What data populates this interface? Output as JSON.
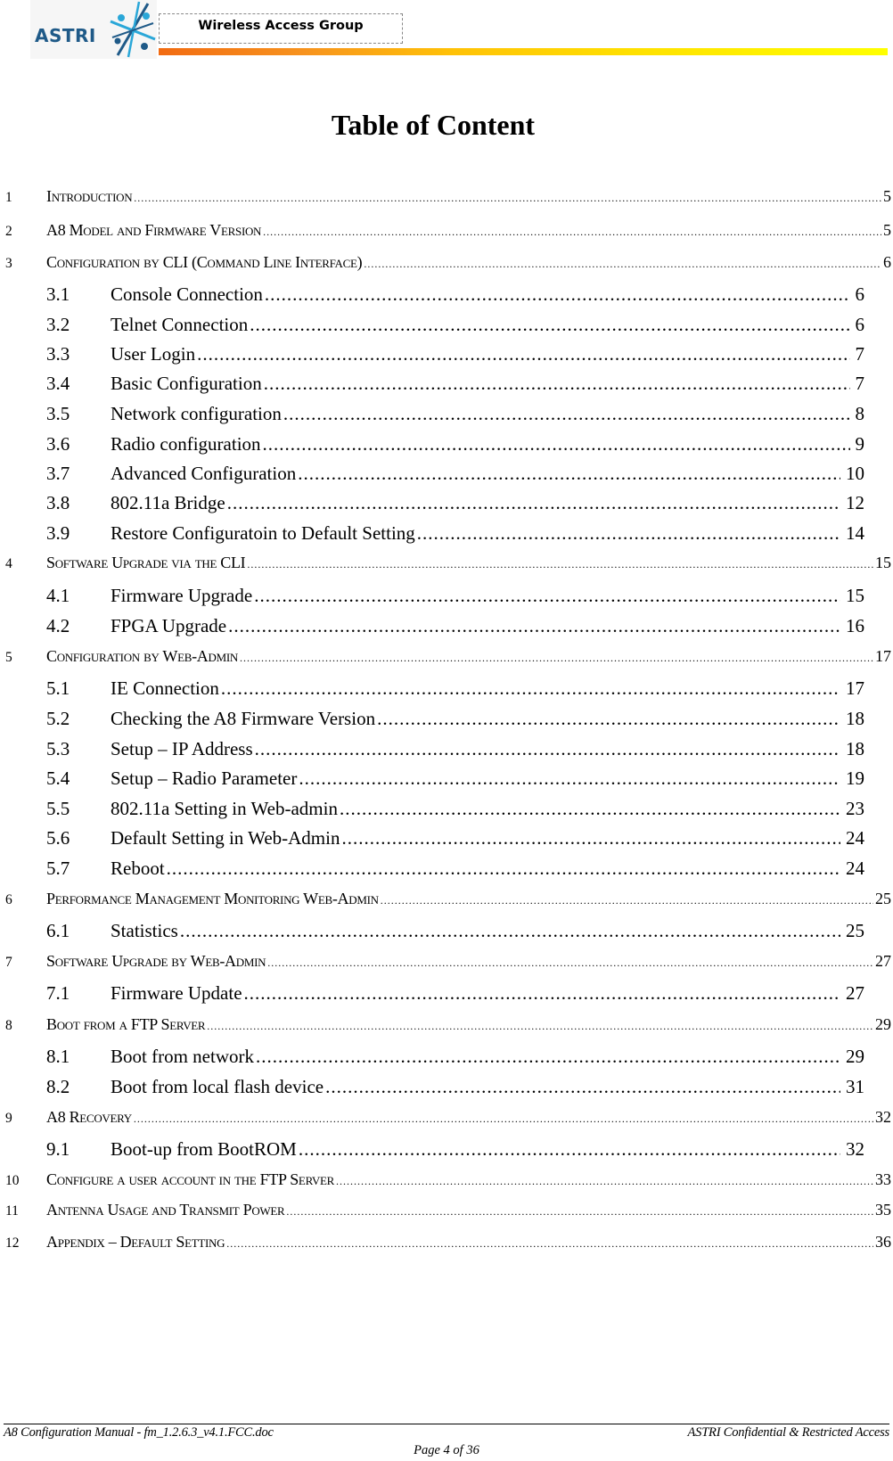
{
  "header": {
    "logo_text": "ASTRI",
    "group_label": "Wireless Access Group",
    "colors": {
      "logo_blue": "#1f5a88",
      "logo_cyan": "#2aa7d8",
      "bar_start": "#f26b12",
      "bar_end": "#ffff00"
    }
  },
  "title": "Table of Content",
  "toc": [
    {
      "level": 1,
      "num": "1",
      "title": "Introduction",
      "page": "5"
    },
    {
      "level": 1,
      "num": "2",
      "title": "A8 Model and Firmware Version",
      "page": "5"
    },
    {
      "level": 1,
      "num": "3",
      "title": "Configuration by CLI (Command Line Interface)",
      "page": "6"
    },
    {
      "level": 2,
      "num": "3.1",
      "title": "Console Connection",
      "page": "6"
    },
    {
      "level": 2,
      "num": "3.2",
      "title": "Telnet Connection",
      "page": "6"
    },
    {
      "level": 2,
      "num": "3.3",
      "title": "User Login",
      "page": "7"
    },
    {
      "level": 2,
      "num": "3.4",
      "title": "Basic Configuration",
      "page": "7"
    },
    {
      "level": 2,
      "num": "3.5",
      "title": "Network configuration",
      "page": "8"
    },
    {
      "level": 2,
      "num": "3.6",
      "title": "Radio configuration",
      "page": "9"
    },
    {
      "level": 2,
      "num": "3.7",
      "title": "Advanced Configuration",
      "page": "10"
    },
    {
      "level": 2,
      "num": "3.8",
      "title": "802.11a Bridge",
      "page": "12"
    },
    {
      "level": 2,
      "num": "3.9",
      "title": "Restore Configuratoin to Default Setting",
      "page": "14"
    },
    {
      "level": 1,
      "num": "4",
      "title": "Software Upgrade via the CLI",
      "page": "15"
    },
    {
      "level": 2,
      "num": "4.1",
      "title": "Firmware Upgrade",
      "page": "15"
    },
    {
      "level": 2,
      "num": "4.2",
      "title": "FPGA Upgrade",
      "page": "16"
    },
    {
      "level": 1,
      "num": "5",
      "title": "Configuration by Web-Admin",
      "page": "17"
    },
    {
      "level": 2,
      "num": "5.1",
      "title": "IE Connection",
      "page": "17"
    },
    {
      "level": 2,
      "num": "5.2",
      "title": "Checking the A8 Firmware Version",
      "page": "18"
    },
    {
      "level": 2,
      "num": "5.3",
      "title": "Setup – IP Address",
      "page": "18"
    },
    {
      "level": 2,
      "num": "5.4",
      "title": "Setup – Radio Parameter",
      "page": "19"
    },
    {
      "level": 2,
      "num": "5.5",
      "title": "802.11a Setting in Web-admin",
      "page": "23"
    },
    {
      "level": 2,
      "num": "5.6",
      "title": "Default Setting in Web-Admin",
      "page": "24"
    },
    {
      "level": 2,
      "num": "5.7",
      "title": "Reboot",
      "page": "24"
    },
    {
      "level": 1,
      "num": "6",
      "title": "Performance Management Monitoring Web-Admin",
      "page": "25"
    },
    {
      "level": 2,
      "num": "6.1",
      "title": "Statistics",
      "page": "25"
    },
    {
      "level": 1,
      "num": "7",
      "title": "Software Upgrade by Web-Admin",
      "page": "27"
    },
    {
      "level": 2,
      "num": "7.1",
      "title": "Firmware Update",
      "page": "27"
    },
    {
      "level": 1,
      "num": "8",
      "title": "Boot from a FTP Server",
      "page": "29"
    },
    {
      "level": 2,
      "num": "8.1",
      "title": "Boot from network",
      "page": "29"
    },
    {
      "level": 2,
      "num": "8.2",
      "title": "Boot from local flash device",
      "page": "31"
    },
    {
      "level": 1,
      "num": "9",
      "title": "A8 Recovery",
      "page": "32"
    },
    {
      "level": 2,
      "num": "9.1",
      "title": "Boot-up from BootROM",
      "page": "32"
    },
    {
      "level": 1,
      "num": "10",
      "title": "Configure a user account in the FTP Server",
      "page": "33"
    },
    {
      "level": 1,
      "num": "11",
      "title": "Antenna Usage and Transmit Power",
      "page": "35"
    },
    {
      "level": 1,
      "num": "12",
      "title": "Appendix – Default Setting",
      "page": "36"
    }
  ],
  "footer": {
    "left": "A8 Configuration Manual - fm_1.2.6.3_v4.1.FCC.doc",
    "right": "ASTRI Confidential & Restricted Access",
    "page": "Page 4 of 36"
  }
}
